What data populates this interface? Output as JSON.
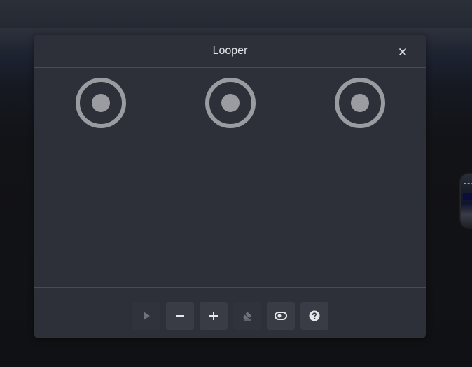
{
  "dialog": {
    "title": "Looper",
    "close_icon": "close-icon"
  },
  "loop_slots": [
    {
      "icon": "record-icon",
      "state": "empty"
    },
    {
      "icon": "record-icon",
      "state": "empty"
    },
    {
      "icon": "record-icon",
      "state": "empty"
    }
  ],
  "toolbar": {
    "buttons": [
      {
        "name": "play",
        "icon": "play-icon",
        "enabled": false
      },
      {
        "name": "decrease",
        "icon": "minus-icon",
        "enabled": true
      },
      {
        "name": "increase",
        "icon": "plus-icon",
        "enabled": true
      },
      {
        "name": "erase",
        "icon": "eraser-icon",
        "enabled": false
      },
      {
        "name": "toggle",
        "icon": "toggle-icon",
        "enabled": true
      },
      {
        "name": "help",
        "icon": "help-icon",
        "enabled": true
      }
    ]
  },
  "colors": {
    "dialog_bg": "#2d3039",
    "button_bg": "#393c45",
    "ring": "#9b9ca2",
    "title_text": "#e6e7ea",
    "divider": "#474b55"
  }
}
